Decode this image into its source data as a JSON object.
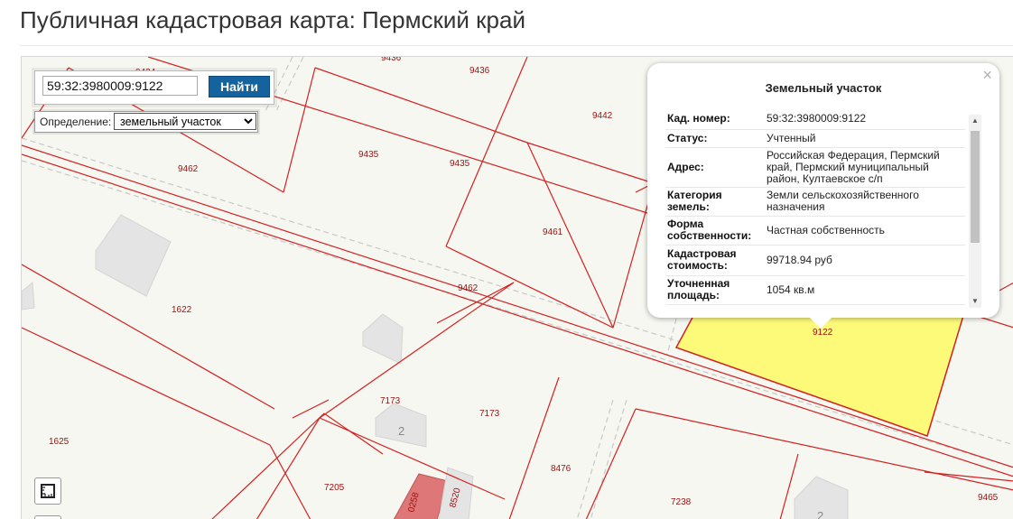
{
  "page": {
    "title": "Публичная кадастровая карта: Пермский край"
  },
  "search": {
    "value": "59:32:3980009:9122",
    "button_label": "Найти"
  },
  "definition": {
    "label": "Определение:",
    "selected": "земельный участок"
  },
  "popup": {
    "title": "Земельный участок",
    "close_symbol": "×",
    "rows": [
      {
        "key": "Кад. номер:",
        "value": "59:32:3980009:9122"
      },
      {
        "key": "Статус:",
        "value": "Учтенный"
      },
      {
        "key": "Адрес:",
        "value": "Российская Федерация, Пермский край, Пермский муниципальный район, Култаевское с/п"
      },
      {
        "key": "Категория земель:",
        "value": "Земли сельскохозяйственного назначения"
      },
      {
        "key": "Форма собственности:",
        "value": "Частная собственность"
      },
      {
        "key": "Кадастровая стоимость:",
        "value": "99718.94 руб"
      },
      {
        "key": "Уточненная площадь:",
        "value": "1054 кв.м"
      }
    ]
  },
  "map": {
    "parcel_labels": [
      "9436",
      "9442",
      "9435",
      "9435",
      "9462",
      "9461",
      "9462",
      "1622",
      "7173",
      "7173",
      "1625",
      "7205",
      "8476",
      "7238",
      "9465",
      "9122",
      "0258",
      "8520",
      "9434",
      "9436"
    ],
    "building_labels": [
      "2",
      "2"
    ],
    "colors": {
      "boundary": "#d42020",
      "label": "#9c1010",
      "selected_parcel": "#fdfa7a",
      "road": "#bbbbbb",
      "background": "#f7f7f1",
      "building": "#e3e3e3",
      "building_highlight": "#de7777"
    }
  },
  "icons": {
    "measure": "ruler-icon"
  }
}
